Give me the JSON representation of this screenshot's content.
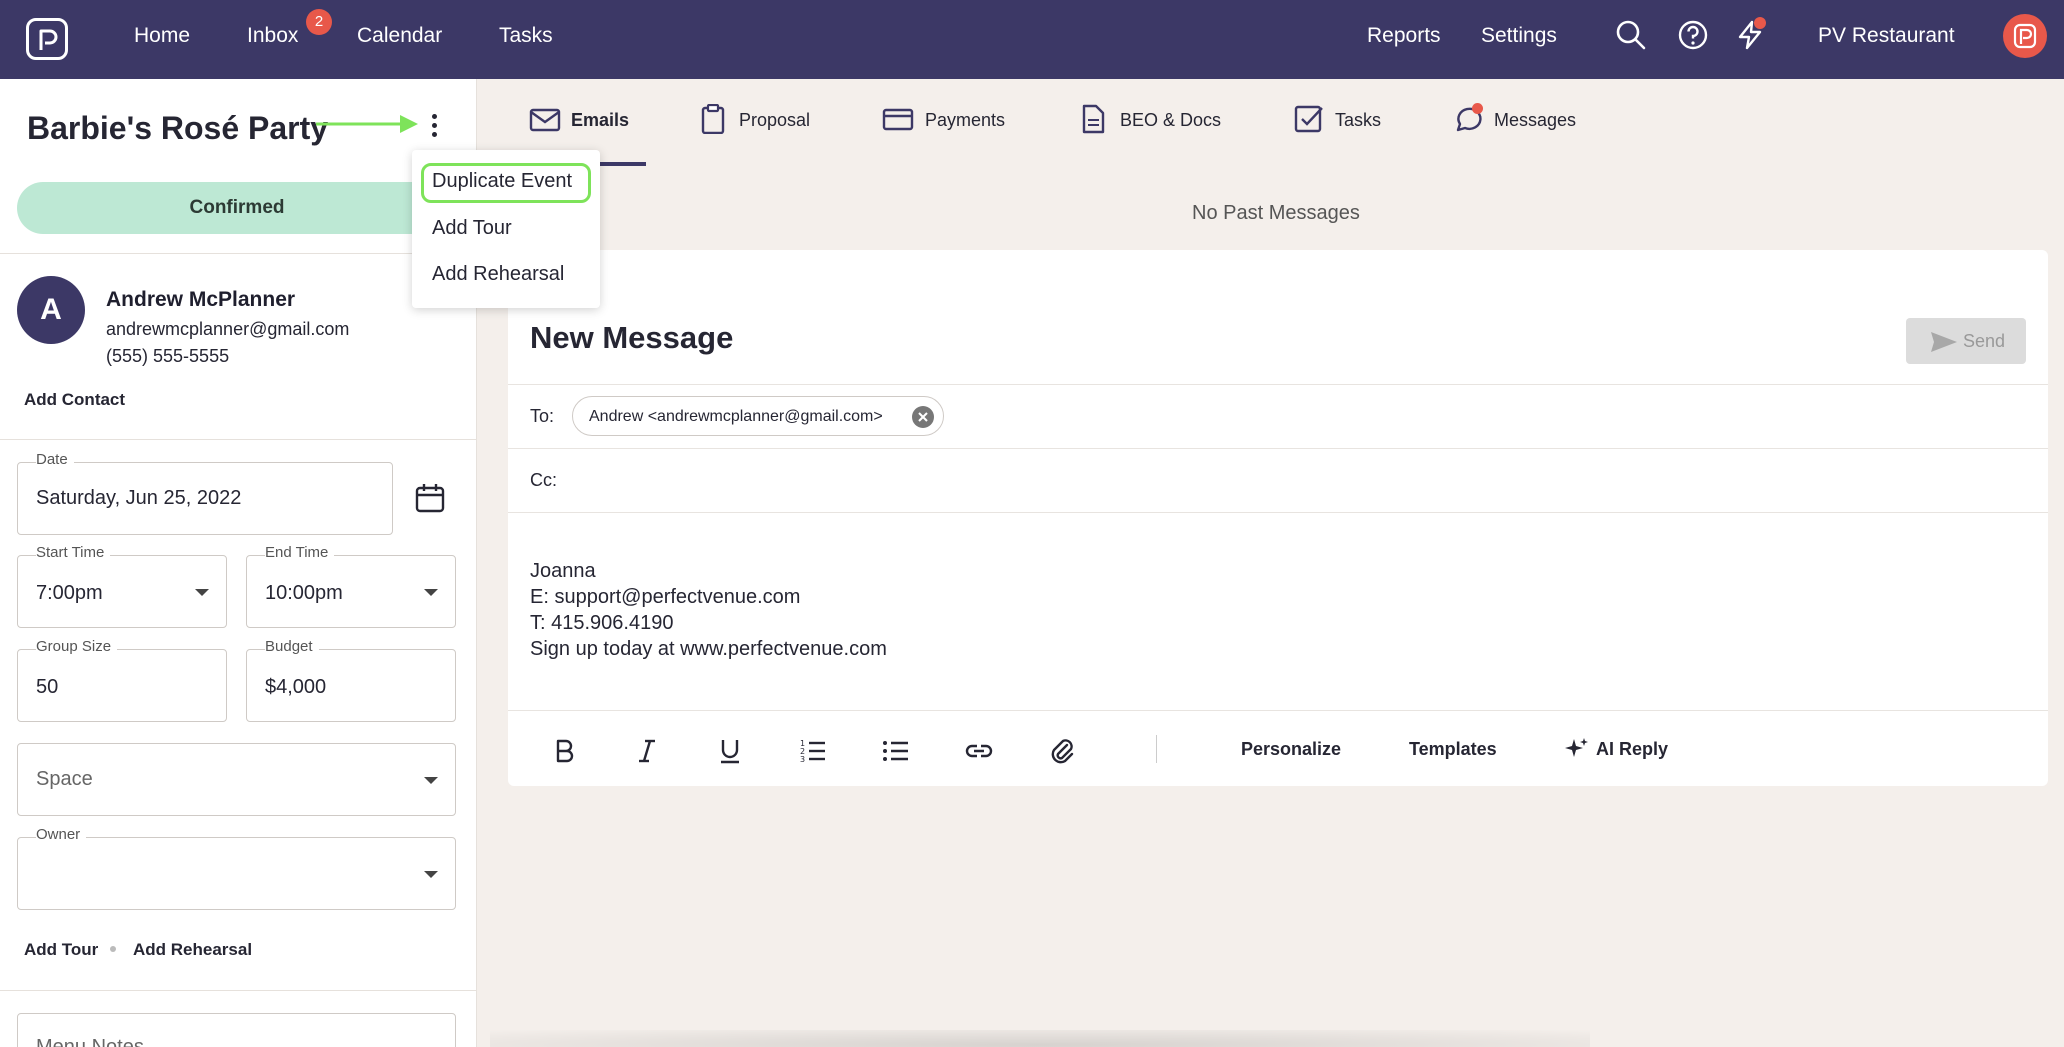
{
  "nav": {
    "items": [
      "Home",
      "Inbox",
      "Calendar",
      "Tasks"
    ],
    "inbox_badge": "2",
    "right_items": [
      "Reports",
      "Settings"
    ],
    "account": "PV Restaurant"
  },
  "event": {
    "title": "Barbie's Rosé Party",
    "status": "Confirmed"
  },
  "menu": {
    "items": [
      "Duplicate Event",
      "Add Tour",
      "Add Rehearsal"
    ]
  },
  "contact": {
    "initial": "A",
    "name": "Andrew McPlanner",
    "email": "andrewmcplanner@gmail.com",
    "phone": "(555) 555-5555",
    "add_contact": "Add Contact"
  },
  "fields": {
    "date_label": "Date",
    "date_value": "Saturday, Jun 25, 2022",
    "start_label": "Start Time",
    "start_value": "7:00pm",
    "end_label": "End Time",
    "end_value": "10:00pm",
    "group_label": "Group Size",
    "group_value": "50",
    "budget_label": "Budget",
    "budget_value": "$4,000",
    "space_placeholder": "Space",
    "owner_label": "Owner",
    "menu_notes_placeholder": "Menu Notes"
  },
  "links": {
    "add_tour": "Add Tour",
    "add_rehearsal": "Add Rehearsal"
  },
  "tabs": [
    "Emails",
    "Proposal",
    "Payments",
    "BEO & Docs",
    "Tasks",
    "Messages"
  ],
  "compose": {
    "no_past": "No Past Messages",
    "title": "New Message",
    "send": "Send",
    "to_label": "To:",
    "to_chip": "Andrew <andrewmcplanner@gmail.com>",
    "cc_label": "Cc:",
    "signature": [
      "Joanna",
      "E: support@perfectvenue.com",
      "T: 415.906.4190",
      "Sign up today at www.perfectvenue.com"
    ],
    "toolbar": {
      "personalize": "Personalize",
      "templates": "Templates",
      "ai_reply": "AI Reply"
    }
  },
  "colors": {
    "nav_bg": "#3c3866",
    "accent_red": "#e8584a",
    "confirmed_bg": "#bde8d4",
    "highlight_green": "#7ee35a"
  }
}
